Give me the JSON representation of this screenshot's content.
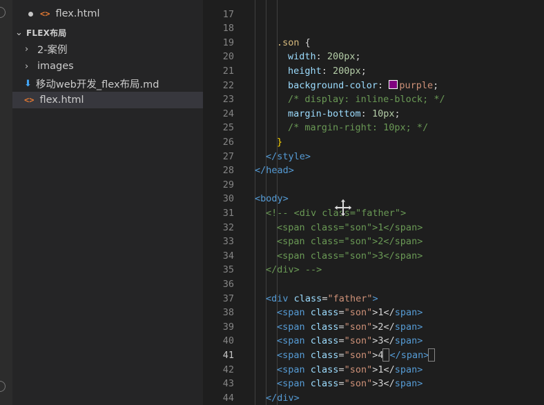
{
  "sidebar": {
    "open_editor_file": "flex.html",
    "folder_title": "FLEX布局",
    "items": [
      {
        "label": "2-案例",
        "type": "folder"
      },
      {
        "label": "images",
        "type": "folder"
      },
      {
        "label": "移动web开发_flex布局.md",
        "type": "markdown"
      },
      {
        "label": "flex.html",
        "type": "html",
        "selected": true
      }
    ]
  },
  "editor": {
    "current_line": 41,
    "swatch_color": "#800080",
    "lines": [
      {
        "n": "17"
      },
      {
        "n": "18"
      },
      {
        "n": "19",
        "t": [
          ".son",
          " {"
        ]
      },
      {
        "n": "20",
        "t": [
          "width",
          ": ",
          "200px",
          ";"
        ]
      },
      {
        "n": "21",
        "t": [
          "height",
          ": ",
          "200px",
          ";"
        ]
      },
      {
        "n": "22",
        "t": [
          "background-color",
          ": ",
          "purple",
          ";"
        ]
      },
      {
        "n": "23",
        "t": [
          "/* display: inline-block; */"
        ]
      },
      {
        "n": "24",
        "t": [
          "margin-bottom",
          ": ",
          "10px",
          ";"
        ]
      },
      {
        "n": "25",
        "t": [
          "/* margin-right: 10px; */"
        ]
      },
      {
        "n": "26",
        "t": [
          "}"
        ]
      },
      {
        "n": "27",
        "t": [
          "</",
          "style",
          ">"
        ]
      },
      {
        "n": "28",
        "t": [
          "</",
          "head",
          ">"
        ]
      },
      {
        "n": "29"
      },
      {
        "n": "30",
        "t": [
          "<",
          "body",
          ">"
        ]
      },
      {
        "n": "31",
        "t": [
          "<!-- <div class=\"father\">"
        ]
      },
      {
        "n": "32",
        "t": [
          "<span class=\"son\">1</span>"
        ]
      },
      {
        "n": "33",
        "t": [
          "<span class=\"son\">2</span>"
        ]
      },
      {
        "n": "34",
        "t": [
          "<span class=\"son\">3</span>"
        ]
      },
      {
        "n": "35",
        "t": [
          "</div> -->"
        ]
      },
      {
        "n": "36"
      },
      {
        "n": "37",
        "t": [
          "<",
          "div",
          " class",
          "=",
          "\"father\"",
          ">"
        ]
      },
      {
        "n": "38",
        "t": [
          "<",
          "span",
          " class",
          "=",
          "\"son\"",
          ">1</",
          "span",
          ">"
        ]
      },
      {
        "n": "39",
        "t": [
          "<",
          "span",
          " class",
          "=",
          "\"son\"",
          ">2</",
          "span",
          ">"
        ]
      },
      {
        "n": "40",
        "t": [
          "<",
          "span",
          " class",
          "=",
          "\"son\"",
          ">3</",
          "span",
          ">"
        ]
      },
      {
        "n": "41",
        "t": [
          "<",
          "span",
          " class",
          "=",
          "\"son\"",
          ">4",
          "</",
          "span",
          ">"
        ]
      },
      {
        "n": "42",
        "t": [
          "<",
          "span",
          " class",
          "=",
          "\"son\"",
          ">1</",
          "span",
          ">"
        ]
      },
      {
        "n": "43",
        "t": [
          "<",
          "span",
          " class",
          "=",
          "\"son\"",
          ">3</",
          "span",
          ">"
        ]
      },
      {
        "n": "44",
        "t": [
          "</",
          "div",
          ">"
        ]
      }
    ]
  }
}
